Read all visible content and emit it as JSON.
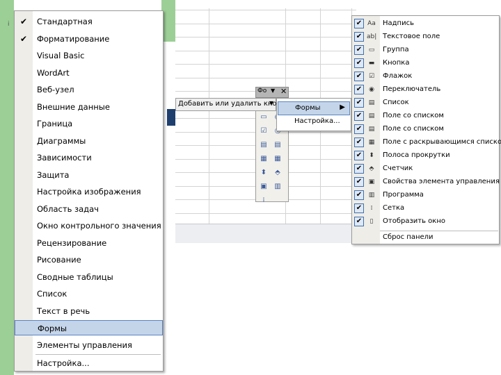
{
  "toolbars_menu": {
    "items": [
      {
        "label": "Стандартная",
        "checked": true
      },
      {
        "label": "Форматирование",
        "checked": true
      },
      {
        "label": "Visual Basic",
        "checked": false
      },
      {
        "label": "WordArt",
        "checked": false
      },
      {
        "label": "Веб-узел",
        "checked": false
      },
      {
        "label": "Внешние данные",
        "checked": false
      },
      {
        "label": "Граница",
        "checked": false
      },
      {
        "label": "Диаграммы",
        "checked": false
      },
      {
        "label": "Зависимости",
        "checked": false
      },
      {
        "label": "Защита",
        "checked": false
      },
      {
        "label": "Настройка изображения",
        "checked": false
      },
      {
        "label": "Область задач",
        "checked": false
      },
      {
        "label": "Окно контрольного значения",
        "checked": false
      },
      {
        "label": "Рецензирование",
        "checked": false
      },
      {
        "label": "Рисование",
        "checked": false
      },
      {
        "label": "Сводные таблицы",
        "checked": false
      },
      {
        "label": "Список",
        "checked": false
      },
      {
        "label": "Текст в речь",
        "checked": false
      },
      {
        "label": "Формы",
        "checked": false,
        "highlighted": true
      },
      {
        "label": "Элементы управления",
        "checked": false
      }
    ],
    "customize_label": "Настройка..."
  },
  "forms_toolbar": {
    "title": "Фо",
    "add_remove_label": "Добавить или удалить кнопки"
  },
  "add_remove_submenu": {
    "forms_label": "Формы",
    "customize_label": "Настройка..."
  },
  "forms_buttons_list": {
    "items": [
      {
        "label": "Надпись",
        "icon": "label-icon"
      },
      {
        "label": "Текстовое поле",
        "icon": "textbox-icon"
      },
      {
        "label": "Группа",
        "icon": "group-icon"
      },
      {
        "label": "Кнопка",
        "icon": "button-icon"
      },
      {
        "label": "Флажок",
        "icon": "checkbox-icon"
      },
      {
        "label": "Переключатель",
        "icon": "option-button-icon"
      },
      {
        "label": "Список",
        "icon": "listbox-icon"
      },
      {
        "label": "Поле со списком",
        "icon": "combobox-icon"
      },
      {
        "label": "Поле со списком",
        "icon": "combobox-icon"
      },
      {
        "label": "Поле с раскрывающимся списком",
        "icon": "dropdown-icon"
      },
      {
        "label": "Полоса прокрутки",
        "icon": "scrollbar-icon"
      },
      {
        "label": "Счетчик",
        "icon": "spinner-icon"
      },
      {
        "label": "Свойства элемента управления",
        "icon": "properties-icon"
      },
      {
        "label": "Программа",
        "icon": "code-icon"
      },
      {
        "label": "Сетка",
        "icon": "grid-icon"
      },
      {
        "label": "Отобразить окно",
        "icon": "dialog-icon"
      }
    ],
    "reset_label": "Сброс панели"
  },
  "colors": {
    "highlight": "#c4d5ea",
    "highlight_border": "#5b83be",
    "sheet_green": "#9ccf96",
    "check_border": "#3f6fad"
  }
}
